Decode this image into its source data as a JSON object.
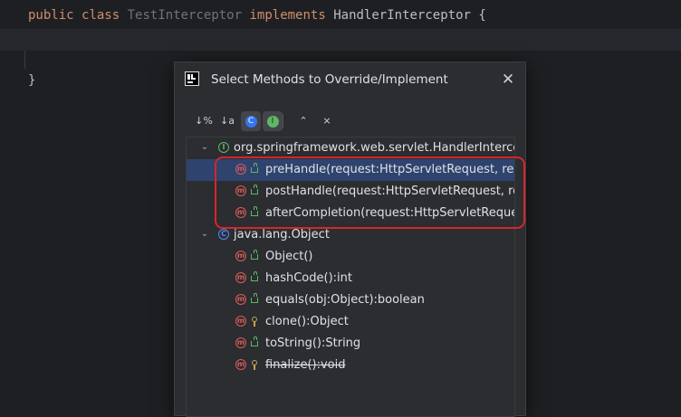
{
  "editor": {
    "line1": {
      "kw_public": "public",
      "kw_class": "class",
      "class_name": "TestInterceptor",
      "kw_implements": "implements",
      "iface": "HandlerInterceptor",
      "brace": "{"
    },
    "line3": {
      "brace": "}"
    }
  },
  "dialog": {
    "title": "Select Methods to Override/Implement",
    "close_symbol": "✕",
    "toolbar": {
      "sort_visibility": "↓%",
      "sort_alpha": "↓a",
      "show_classes": "C",
      "show_interfaces": "I",
      "expand_all": "⌃",
      "collapse_all": "⨯"
    },
    "tree": {
      "groups": [
        {
          "name": "org.springframework.web.servlet.HandlerInterceptor",
          "badge": "I",
          "badge_color": "#5fb865",
          "items": [
            {
              "label": "preHandle(request:HttpServletRequest, response:HttpServletResponse, handler:Object):boolean",
              "selected": true,
              "access": "public"
            },
            {
              "label": "postHandle(request:HttpServletRequest, response:HttpServletResponse, handler:Object, modelAndView:ModelAndView):void",
              "selected": false,
              "access": "public"
            },
            {
              "label": "afterCompletion(request:HttpServletRequest, response:HttpServletResponse, handler:Object, ex:Exception):void",
              "selected": false,
              "access": "public"
            }
          ]
        },
        {
          "name": "java.lang.Object",
          "badge": "C",
          "badge_color": "#548af7",
          "items": [
            {
              "label": "Object()",
              "access": "public"
            },
            {
              "label": "hashCode():int",
              "access": "public"
            },
            {
              "label": "equals(obj:Object):boolean",
              "access": "public"
            },
            {
              "label": "clone():Object",
              "access": "protected"
            },
            {
              "label": "toString():String",
              "access": "public"
            },
            {
              "label": "finalize():void",
              "access": "protected",
              "deprecated": true
            }
          ]
        }
      ],
      "method_badge": "m"
    }
  },
  "colors": {
    "selection": "#2e436e",
    "highlight_box": "#d8242b",
    "keyword": "#cf8e6d"
  }
}
